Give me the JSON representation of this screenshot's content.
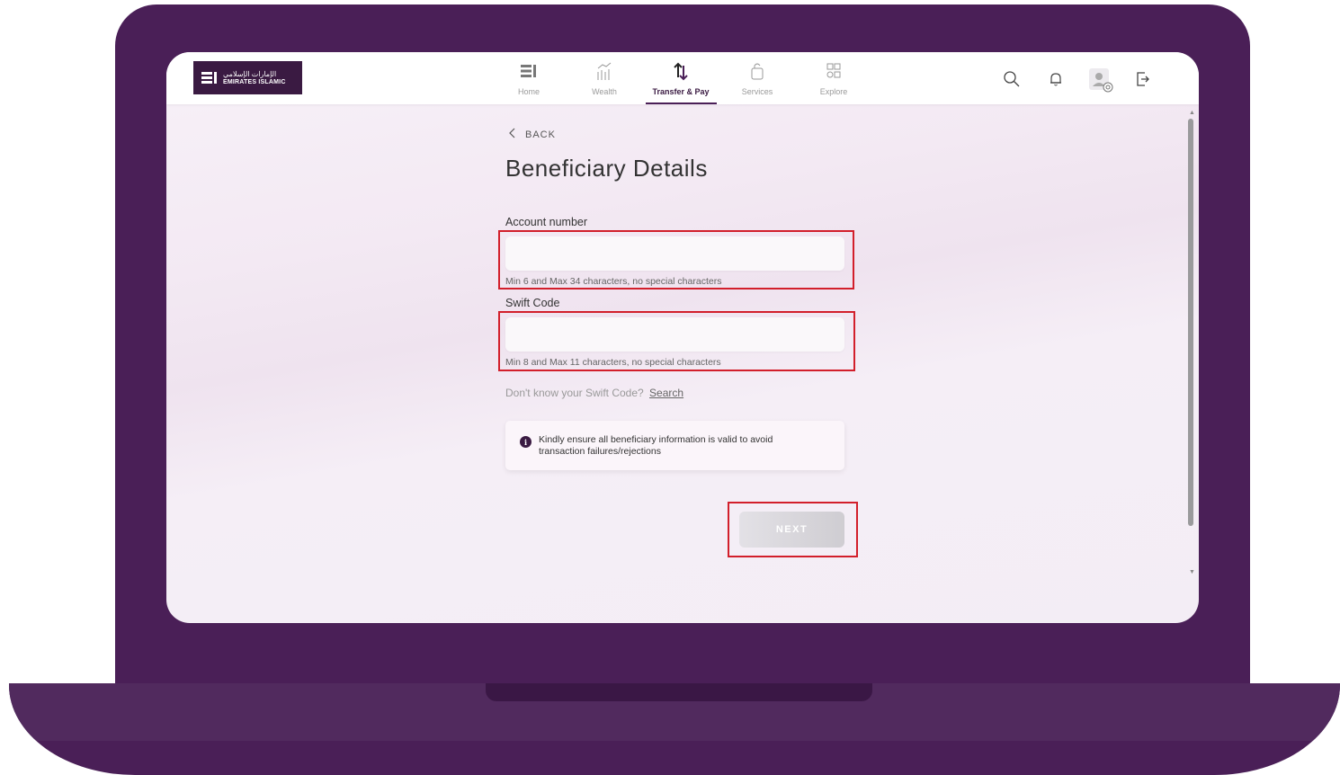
{
  "brand": {
    "logo_arabic": "الإمارات الإسلامي",
    "logo_english": "EMIRATES ISLAMIC"
  },
  "nav": {
    "items": [
      {
        "label": "Home",
        "icon": "home-icon",
        "active": false
      },
      {
        "label": "Wealth",
        "icon": "wealth-icon",
        "active": false
      },
      {
        "label": "Transfer & Pay",
        "icon": "transfer-icon",
        "active": true
      },
      {
        "label": "Services",
        "icon": "services-icon",
        "active": false
      },
      {
        "label": "Explore",
        "icon": "explore-icon",
        "active": false
      }
    ]
  },
  "toolbar": {
    "icons": [
      "search-icon",
      "bell-icon",
      "profile-settings-icon",
      "logout-icon"
    ]
  },
  "page": {
    "back_label": "BACK",
    "title": "Beneficiary Details"
  },
  "form": {
    "account_number": {
      "label": "Account number",
      "value": "",
      "hint": "Min 6 and Max 34 characters, no special characters"
    },
    "swift_code": {
      "label": "Swift Code",
      "value": "",
      "hint": "Min 8 and Max 11 characters, no special characters"
    },
    "swift_help_text": "Don't know your Swift Code?",
    "swift_search_link": "Search",
    "info_message": "Kindly ensure all beneficiary information is valid to avoid transaction failures/rejections",
    "info_icon_glyph": "i",
    "next_label": "NEXT",
    "next_enabled": false
  },
  "colors": {
    "brand_purple": "#4a1f57",
    "logo_bg": "#3a1a42",
    "highlight_red": "#d21f2b"
  }
}
